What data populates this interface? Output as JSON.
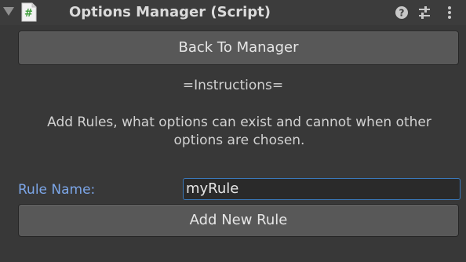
{
  "header": {
    "title": "Options Manager (Script)",
    "icons": [
      "foldout-arrow-icon",
      "csharp-script-icon",
      "help-icon",
      "presets-icon",
      "context-menu-icon"
    ]
  },
  "buttons": {
    "back_label": "Back To Manager",
    "add_label": "Add New Rule"
  },
  "instructions": {
    "title": "=Instructions=",
    "text": "Add Rules, what options can exist and cannot when other options are chosen."
  },
  "rule": {
    "label": "Rule Name:",
    "value": "myRule"
  },
  "colors": {
    "background": "#383838",
    "label_accent": "#7ca6e8",
    "input_focus_border": "#3a79bb",
    "script_icon_green": "#3d9d3a"
  }
}
